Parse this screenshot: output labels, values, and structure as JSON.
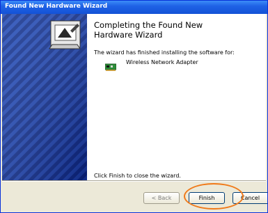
{
  "window": {
    "title": "Found New Hardware Wizard"
  },
  "heading": {
    "line1": "Completing the Found New",
    "line2": "Hardware Wizard"
  },
  "body": {
    "intro": "The wizard has finished installing the software for:",
    "device_label": "Wireless Network Adapter",
    "device_icon": "network-card-icon",
    "footer": "Click Finish to close the wizard."
  },
  "buttons": {
    "back": "< Back",
    "finish": "Finish",
    "cancel": "Cancel"
  },
  "colors": {
    "titlebar": "#1f62e6",
    "sidebar": "#0a2a8a",
    "dialog_bg": "#ece9d8",
    "highlight": "#f07a1a"
  }
}
